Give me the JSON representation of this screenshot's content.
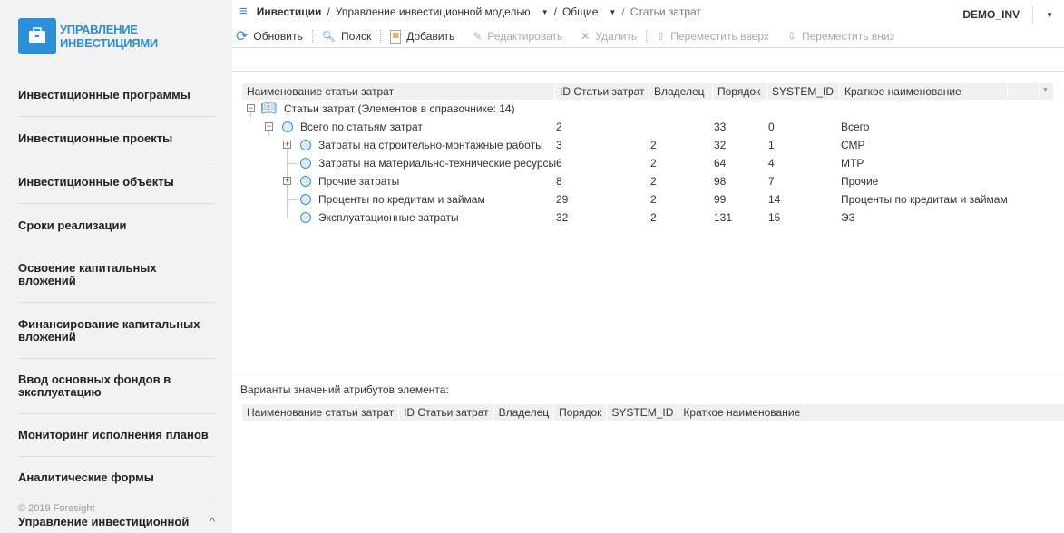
{
  "sidebar": {
    "logo_line1": "УПРАВЛЕНИЕ",
    "logo_line2": "ИНВЕСТИЦИЯМИ",
    "items": [
      "Инвестиционные программы",
      "Инвестиционные проекты",
      "Инвестиционные объекты",
      "Сроки реализации",
      "Освоение капитальных вложений",
      "Финансирование капитальных вложений",
      "Ввод основных фондов в эксплуатацию",
      "Мониторинг исполнения планов",
      "Аналитические формы"
    ],
    "copyright": "© 2019 Foresight",
    "current_module": "Управление инвестиционной моделью"
  },
  "breadcrumb": {
    "root": "Инвестиции",
    "level1": "Управление инвестиционной моделью",
    "level2": "Общие",
    "current": "Статьи затрат"
  },
  "user": "DEMO_INV",
  "toolbar": {
    "refresh": "Обновить",
    "search": "Поиск",
    "add": "Добавить",
    "edit": "Редактировать",
    "delete": "Удалить",
    "move_up": "Переместить вверх",
    "move_down": "Переместить вниз"
  },
  "grid": {
    "columns": [
      "Наименование статьи затрат",
      "ID Статьи затрат",
      "Владелец",
      "Порядок",
      "SYSTEM_ID",
      "Краткое наименование"
    ],
    "root": "Статьи затрат (Элементов в справочнике: 14)",
    "rows": [
      {
        "name": "Всего по статьям затрат",
        "id": "2",
        "owner": "",
        "order": "33",
        "sid": "0",
        "short": "Всего"
      },
      {
        "name": "Затраты на строительно-монтажные работы",
        "id": "3",
        "owner": "2",
        "order": "32",
        "sid": "1",
        "short": "СМР"
      },
      {
        "name": "Затраты на материально-технические ресурсы",
        "id": "6",
        "owner": "2",
        "order": "64",
        "sid": "4",
        "short": "МТР"
      },
      {
        "name": "Прочие затраты",
        "id": "8",
        "owner": "2",
        "order": "98",
        "sid": "7",
        "short": "Прочие"
      },
      {
        "name": "Проценты по кредитам и займам",
        "id": "29",
        "owner": "2",
        "order": "99",
        "sid": "14",
        "short": "Проценты по кредитам и займам"
      },
      {
        "name": "Эксплуатационные затраты",
        "id": "32",
        "owner": "2",
        "order": "131",
        "sid": "15",
        "short": "ЭЗ"
      }
    ]
  },
  "attributes": {
    "label": "Варианты значений атрибутов элемента:",
    "columns": [
      "Наименование статьи затрат",
      "ID Статьи затрат",
      "Владелец",
      "Порядок",
      "SYSTEM_ID",
      "Краткое наименование"
    ]
  }
}
